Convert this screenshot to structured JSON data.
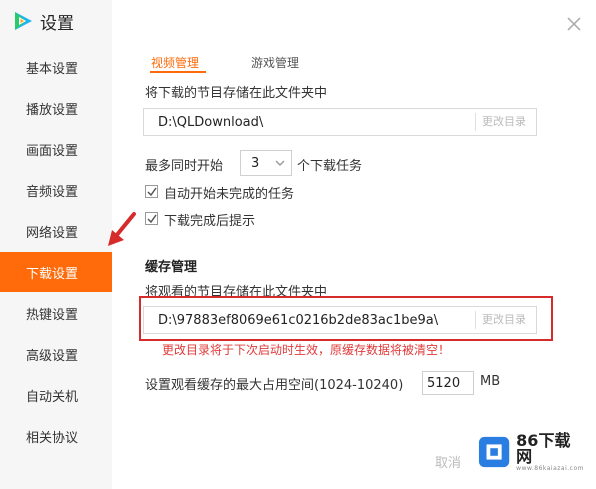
{
  "app": {
    "title": "设置"
  },
  "sidebar": {
    "items": [
      {
        "label": "基本设置",
        "active": false
      },
      {
        "label": "播放设置",
        "active": false
      },
      {
        "label": "画面设置",
        "active": false
      },
      {
        "label": "音频设置",
        "active": false
      },
      {
        "label": "网络设置",
        "active": false
      },
      {
        "label": "下载设置",
        "active": true
      },
      {
        "label": "热键设置",
        "active": false
      },
      {
        "label": "高级设置",
        "active": false
      },
      {
        "label": "自动关机",
        "active": false
      },
      {
        "label": "相关协议",
        "active": false
      }
    ]
  },
  "tabs": [
    {
      "label": "视频管理",
      "active": true
    },
    {
      "label": "游戏管理",
      "active": false
    }
  ],
  "download": {
    "store_label": "将下载的节目存储在此文件夹中",
    "path": "D:\\QLDownload\\",
    "change_label": "更改目录",
    "max_prefix": "最多同时开始",
    "max_value": "3",
    "max_suffix": "个下载任务",
    "auto_start_label": "自动开始未完成的任务",
    "auto_start_checked": true,
    "notify_label": "下载完成后提示",
    "notify_checked": true
  },
  "cache": {
    "section_title": "缓存管理",
    "store_label": "将观看的节目存储在此文件夹中",
    "path": "D:\\97883ef8069e61c0216b2de83ac1be9a\\",
    "change_label": "更改目录",
    "warning": "更改目录将于下次启动时生效，原缓存数据将被清空！",
    "space_label": "设置观看缓存的最大占用空间(1024-10240)",
    "space_value": "5120",
    "space_unit": "MB"
  },
  "footer": {
    "cancel_label": "取消"
  },
  "watermark": {
    "brand": "86下载网",
    "sub": "www.86kaiazai.com"
  },
  "colors": {
    "accent": "#ff6a0a",
    "highlight": "#d62b2b",
    "warning": "#e03a3a"
  }
}
